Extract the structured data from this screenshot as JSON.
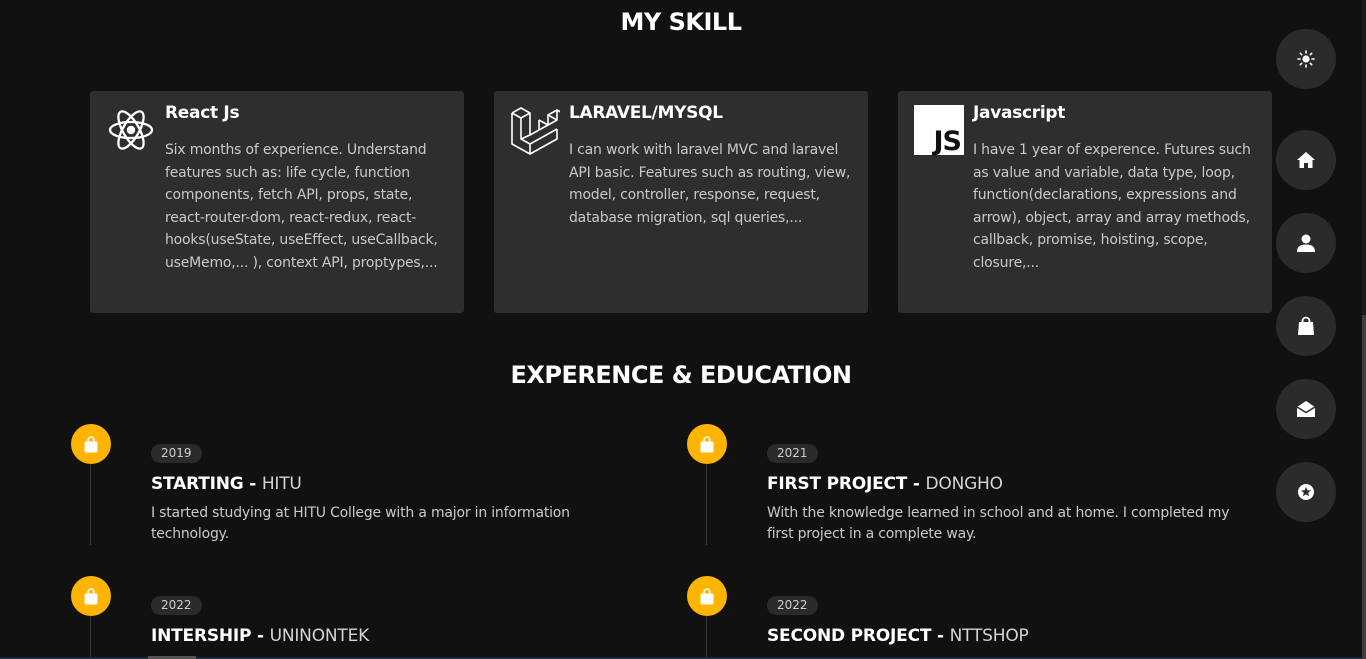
{
  "skills": {
    "title": "MY SKILL",
    "cards": [
      {
        "icon": "react-icon",
        "name": "React Js",
        "description": "Six months of experience. Understand features such as: life cycle, function components, fetch API, props, state, react-router-dom, react-redux, react-hooks(useState, useEffect, useCallback, useMemo,... ), context API, proptypes,..."
      },
      {
        "icon": "laravel-icon",
        "name": "LARAVEL/MYSQL",
        "description": "I can work with laravel MVC and laravel API basic. Features such as routing, view, model, controller, response, request, database migration, sql queries,..."
      },
      {
        "icon": "javascript-icon",
        "icon_text": "JS",
        "name": "Javascript",
        "description": "I have 1 year of experence. Futures such as value and variable, data type, loop, function(declarations, expressions and arrow), object, array and array methods, callback, promise, hoisting, scope, closure,..."
      }
    ]
  },
  "experience": {
    "title": "EXPERENCE & EDUCATION",
    "accent_color": "#ffb400",
    "items": [
      {
        "year": "2019",
        "role": "STARTING",
        "separator": " - ",
        "place": "HITU",
        "description": "I started studying at HITU College with a major in information technology."
      },
      {
        "year": "2021",
        "role": "FIRST PROJECT",
        "separator": " - ",
        "place": "DONGHO",
        "description": "With the knowledge learned in school and at home. I completed my first project in a complete way."
      },
      {
        "year": "2022",
        "role": "INTERSHIP",
        "separator": " - ",
        "place": "UNINONTEK",
        "description": ""
      },
      {
        "year": "2022",
        "role": "SECOND PROJECT",
        "separator": " - ",
        "place": "NTTSHOP",
        "description": ""
      }
    ]
  },
  "sidebar": {
    "buttons": [
      {
        "icon": "sun-icon"
      },
      {
        "icon": "home-icon"
      },
      {
        "icon": "user-icon"
      },
      {
        "icon": "shopping-bag-icon"
      },
      {
        "icon": "envelope-open-icon"
      },
      {
        "icon": "star-badge-icon"
      }
    ]
  }
}
